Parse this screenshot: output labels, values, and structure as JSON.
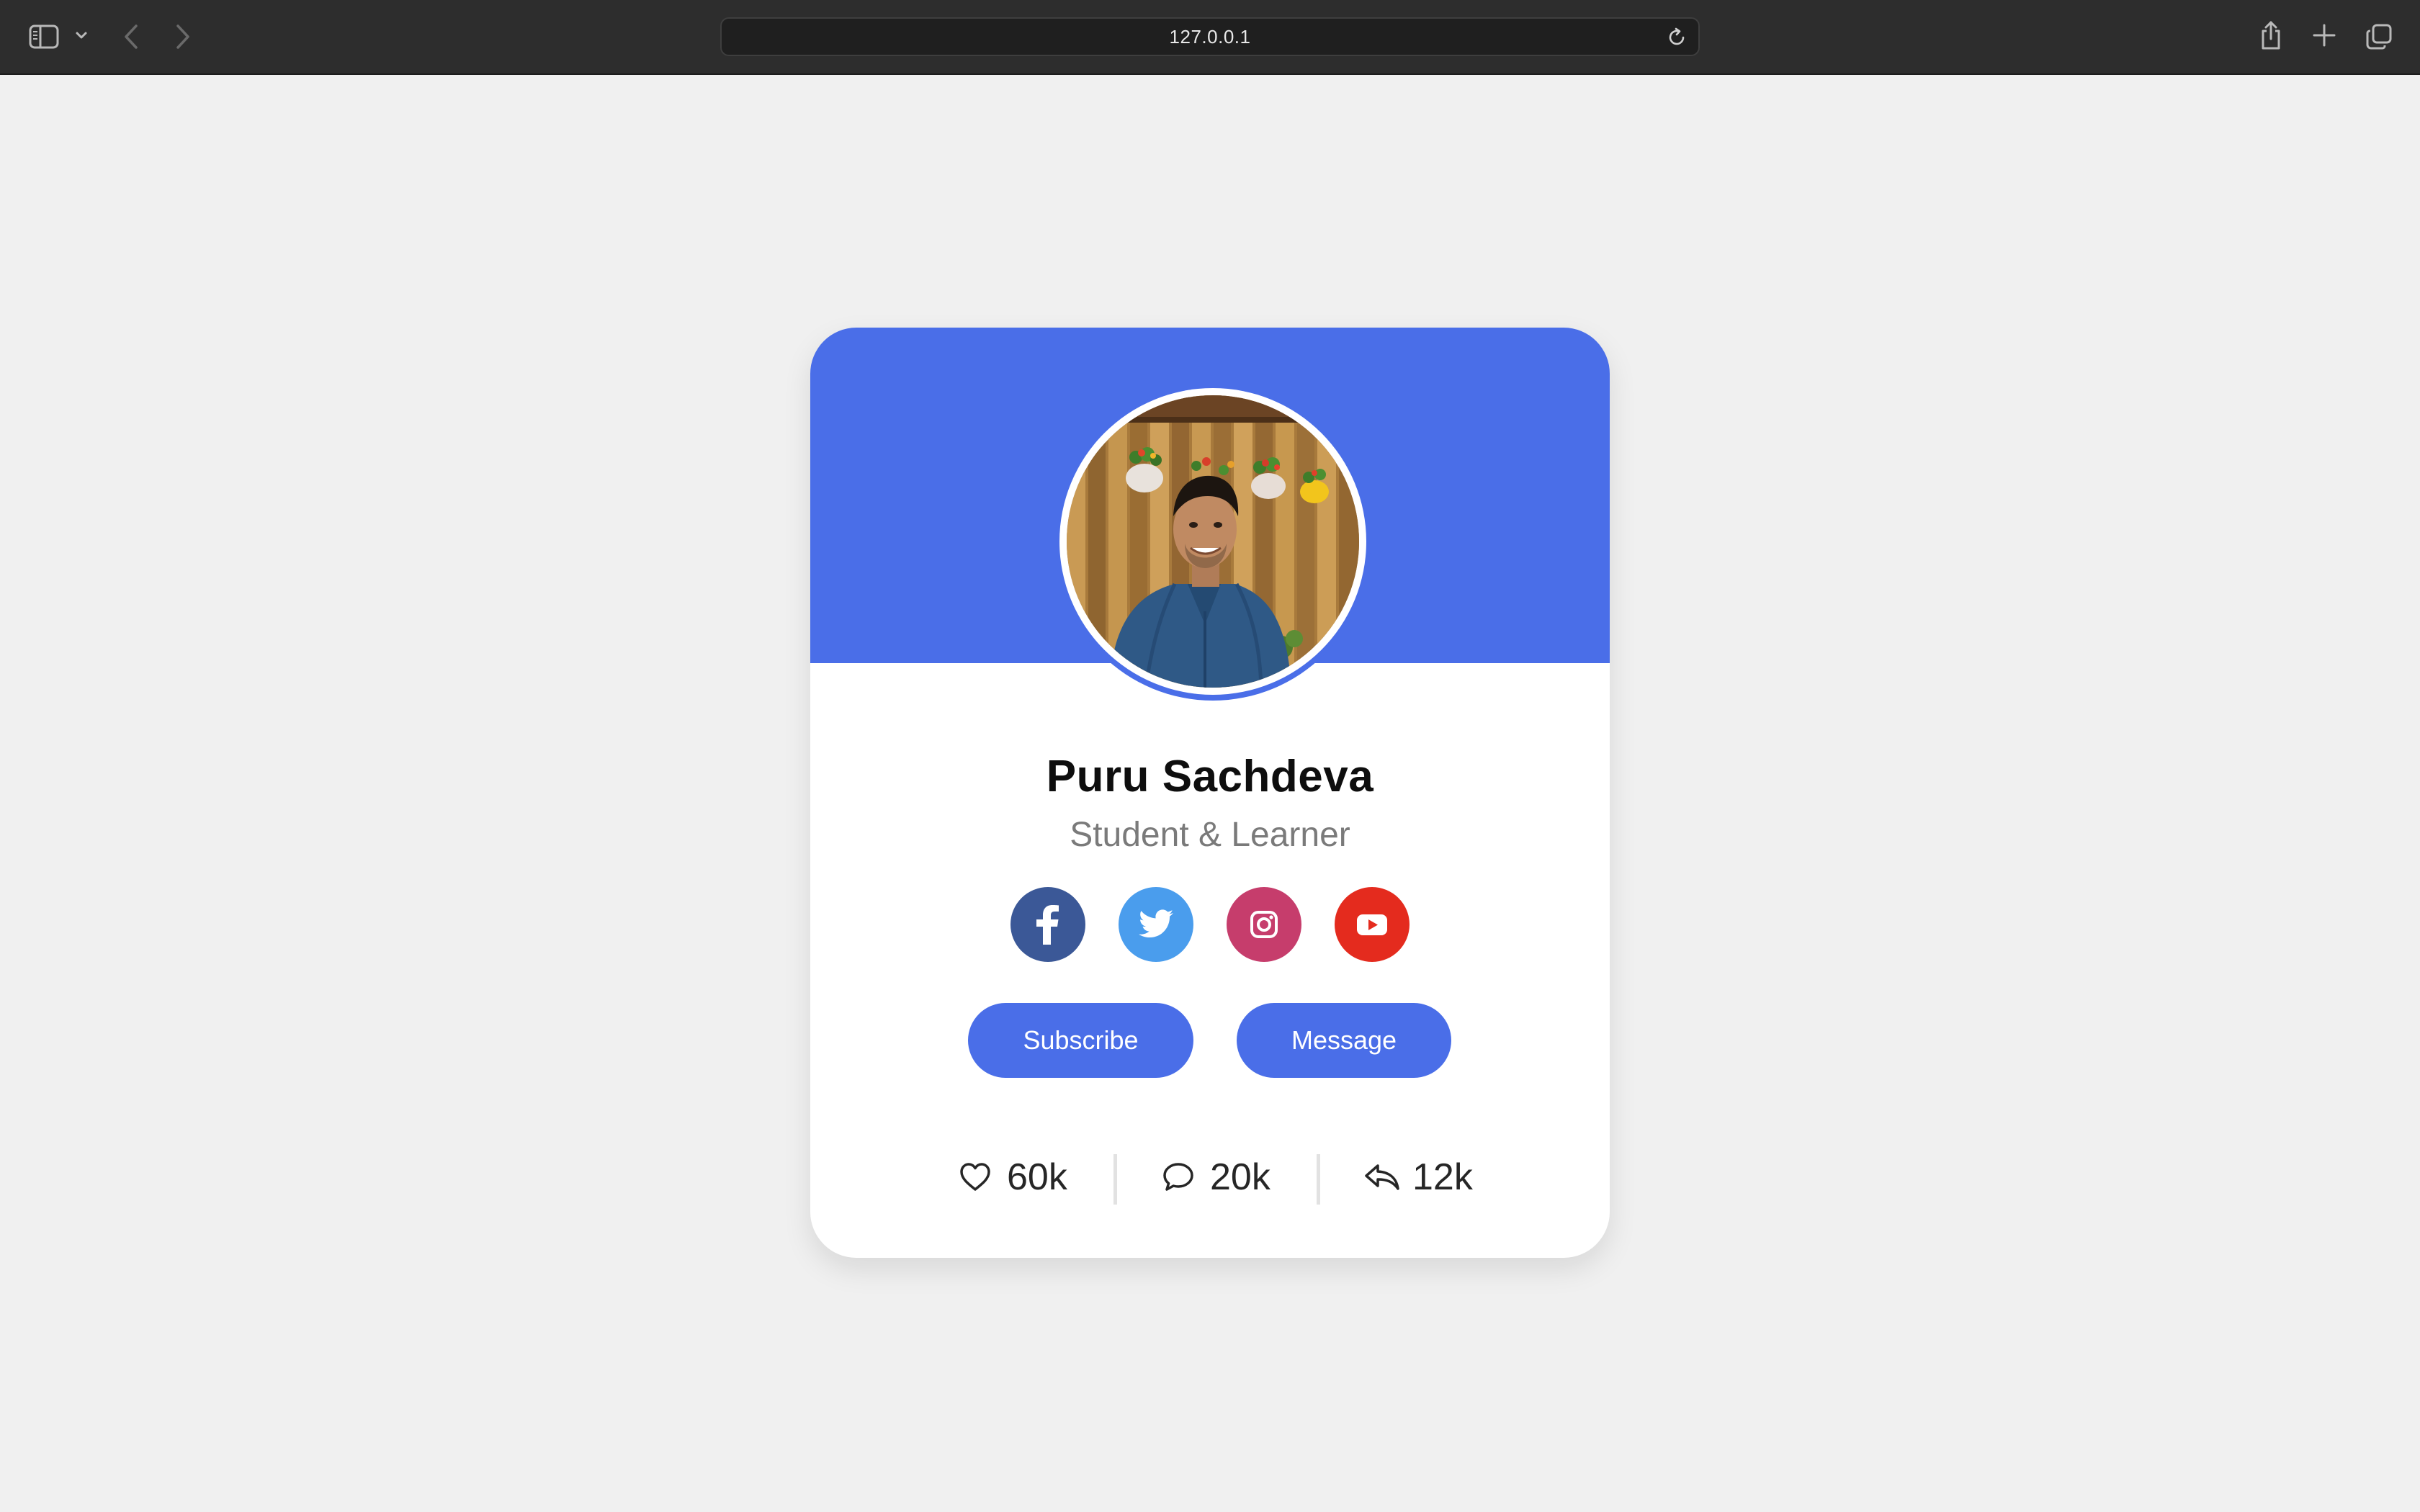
{
  "browser": {
    "url": "127.0.0.1",
    "icons": {
      "sidebar": "sidebar-icon",
      "back": "chevron-left-icon",
      "forward": "chevron-right-icon",
      "reload": "reload-icon",
      "share": "share-icon",
      "new_tab": "plus-icon",
      "tabs": "tabs-overview-icon"
    }
  },
  "profile": {
    "name": "Puru Sachdeva",
    "role": "Student & Learner",
    "social": [
      "facebook-icon",
      "twitter-icon",
      "instagram-icon",
      "youtube-icon"
    ],
    "buttons": {
      "subscribe": "Subscribe",
      "message": "Message"
    },
    "stats": {
      "likes": "60k",
      "comments": "20k",
      "shares": "12k"
    }
  },
  "colors": {
    "accent": "#4a6ee8",
    "facebook": "#3b5897",
    "twitter": "#4a9ded",
    "instagram": "#c63d6c",
    "youtube": "#e42b1e",
    "page_background": "#f0f0f0",
    "chrome_background": "#2d2d2d"
  }
}
